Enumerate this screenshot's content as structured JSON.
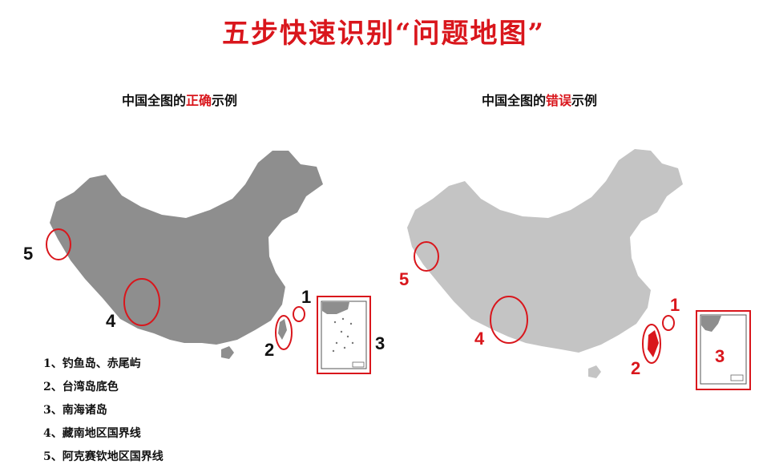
{
  "title": "五步快速识别“问题地图”",
  "left_panel": {
    "caption_prefix": "中国全图的",
    "caption_highlight": "正确",
    "caption_suffix": "示例",
    "markers": [
      "1",
      "2",
      "3",
      "4",
      "5"
    ],
    "map_color": "#8e8e8e",
    "marker_color": "#111111"
  },
  "right_panel": {
    "caption_prefix": "中国全图的",
    "caption_highlight": "错误",
    "caption_suffix": "示例",
    "markers": [
      "1",
      "2",
      "3",
      "4",
      "5"
    ],
    "map_color": "#c4c4c4",
    "marker_color": "#d9161c"
  },
  "legend": [
    "1、钓鱼岛、赤尾屿",
    "2、台湾岛底色",
    "3、南海诸岛",
    "4、藏南地区国界线",
    "5、阿克赛钦地区国界线"
  ],
  "accent_color": "#d9161c"
}
